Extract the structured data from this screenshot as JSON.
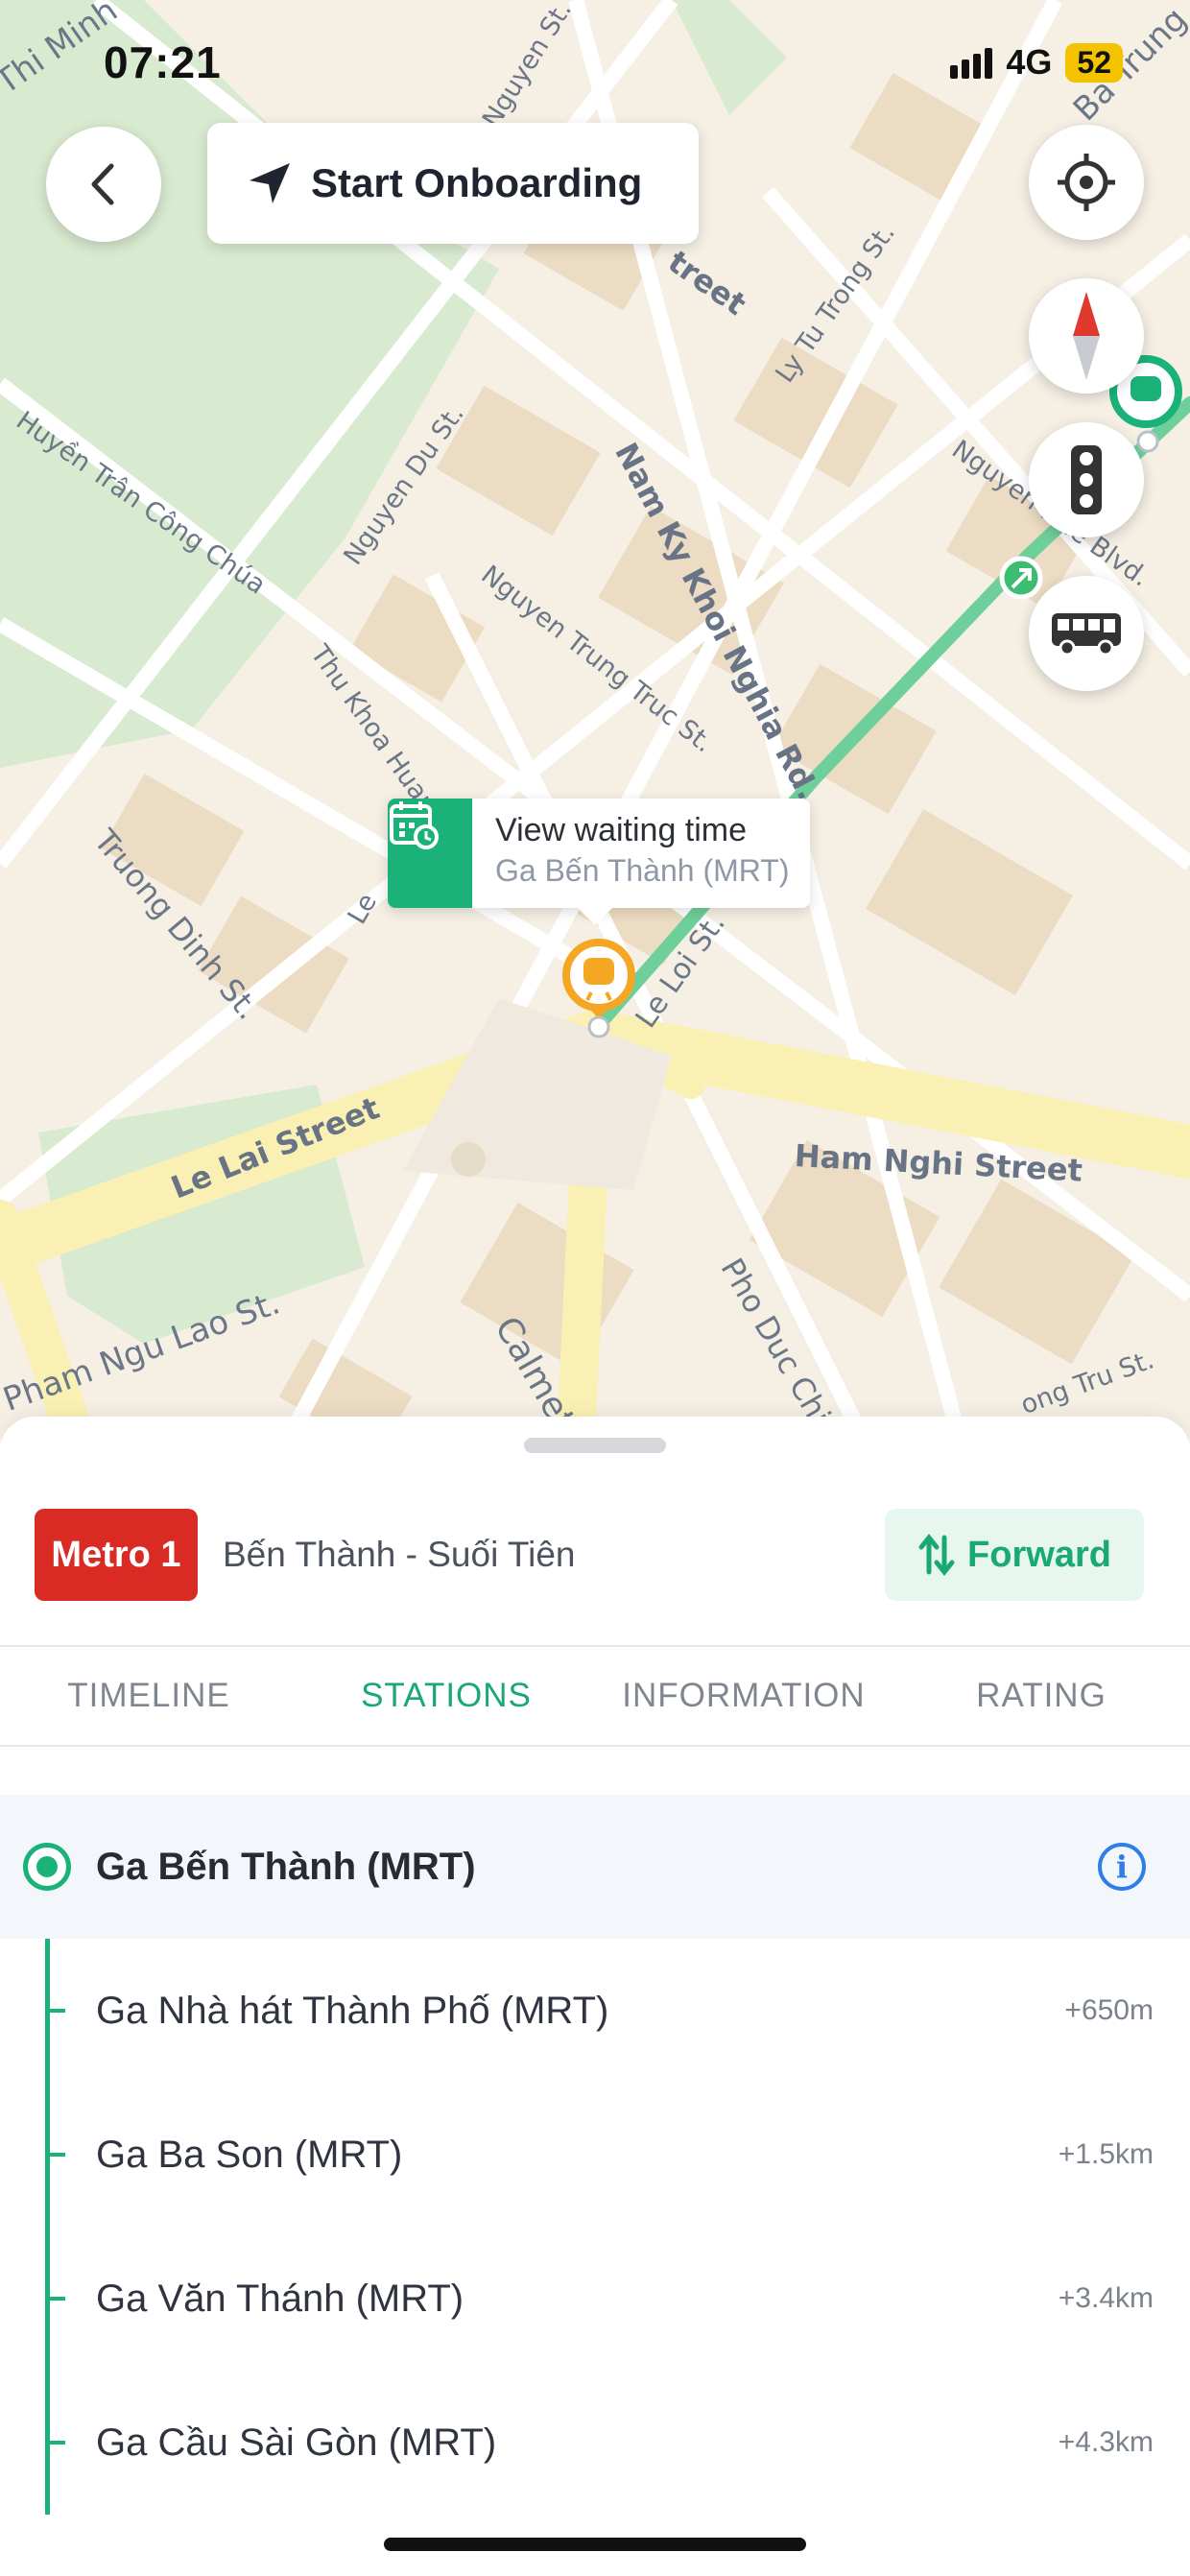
{
  "status_bar": {
    "time": "07:21",
    "network": "4G",
    "battery": "52"
  },
  "map": {
    "onboarding_label": "Start Onboarding",
    "street_labels": {
      "thi_minh": "Thi Minh",
      "nguyen_st": "Nguyen St.",
      "ba_trung": "Ba Trung",
      "street_top": "treet",
      "ly_tu_trong": "Ly Tu Trong St.",
      "huyen_tran": "Huyền Trân Công Chúa",
      "nguyen_du": "Nguyen Du St.",
      "nam_ky": "Nam Ky Khoi Nghia Rd.",
      "nguyen_hue": "Nguyen Hue Blvd.",
      "nguyen_trung_truc": "Nguyen Trung Truc St.",
      "thu_khoa_huan": "Thu Khoa Huan St.",
      "truong_dinh": "Truong Dinh St.",
      "le": "Le",
      "le_loi": "Le Loi St.",
      "le_lai": "Le Lai Street",
      "ham_nghi": "Ham Nghi Street",
      "pham_ngu_lao": "Pham Ngu Lao St.",
      "calmette": "Calmette",
      "pho_duc_chinh": "Pho Duc Chinh",
      "ong_tru": "ong Tru St."
    },
    "popup": {
      "title": "View waiting time",
      "subtitle": "Ga Bến Thành (MRT)"
    },
    "colors": {
      "route": "#6fcf9a",
      "station_marker": "#f5a623",
      "accent": "#1bb27a"
    },
    "icons": {
      "back": "chevron-left-icon",
      "onboarding": "navigation-arrow-icon",
      "locate": "crosshair-icon",
      "compass": "compass-icon",
      "traffic": "traffic-light-icon",
      "bus": "bus-icon",
      "calendar": "calendar-clock-icon"
    }
  },
  "route": {
    "line_badge": "Metro 1",
    "name": "Bến Thành - Suối Tiên",
    "direction_label": "Forward",
    "badge_color": "#d92b24"
  },
  "tabs": [
    {
      "label": "TIMELINE",
      "active": false
    },
    {
      "label": "STATIONS",
      "active": true
    },
    {
      "label": "INFORMATION",
      "active": false
    },
    {
      "label": "RATING",
      "active": false
    }
  ],
  "stations": [
    {
      "name": "Ga Bến Thành (MRT)",
      "distance": "",
      "current": true
    },
    {
      "name": "Ga Nhà hát Thành Phố (MRT)",
      "distance": "+650m",
      "current": false
    },
    {
      "name": "Ga Ba Son (MRT)",
      "distance": "+1.5km",
      "current": false
    },
    {
      "name": "Ga Văn Thánh (MRT)",
      "distance": "+3.4km",
      "current": false
    },
    {
      "name": "Ga Cầu Sài Gòn (MRT)",
      "distance": "+4.3km",
      "current": false
    }
  ]
}
